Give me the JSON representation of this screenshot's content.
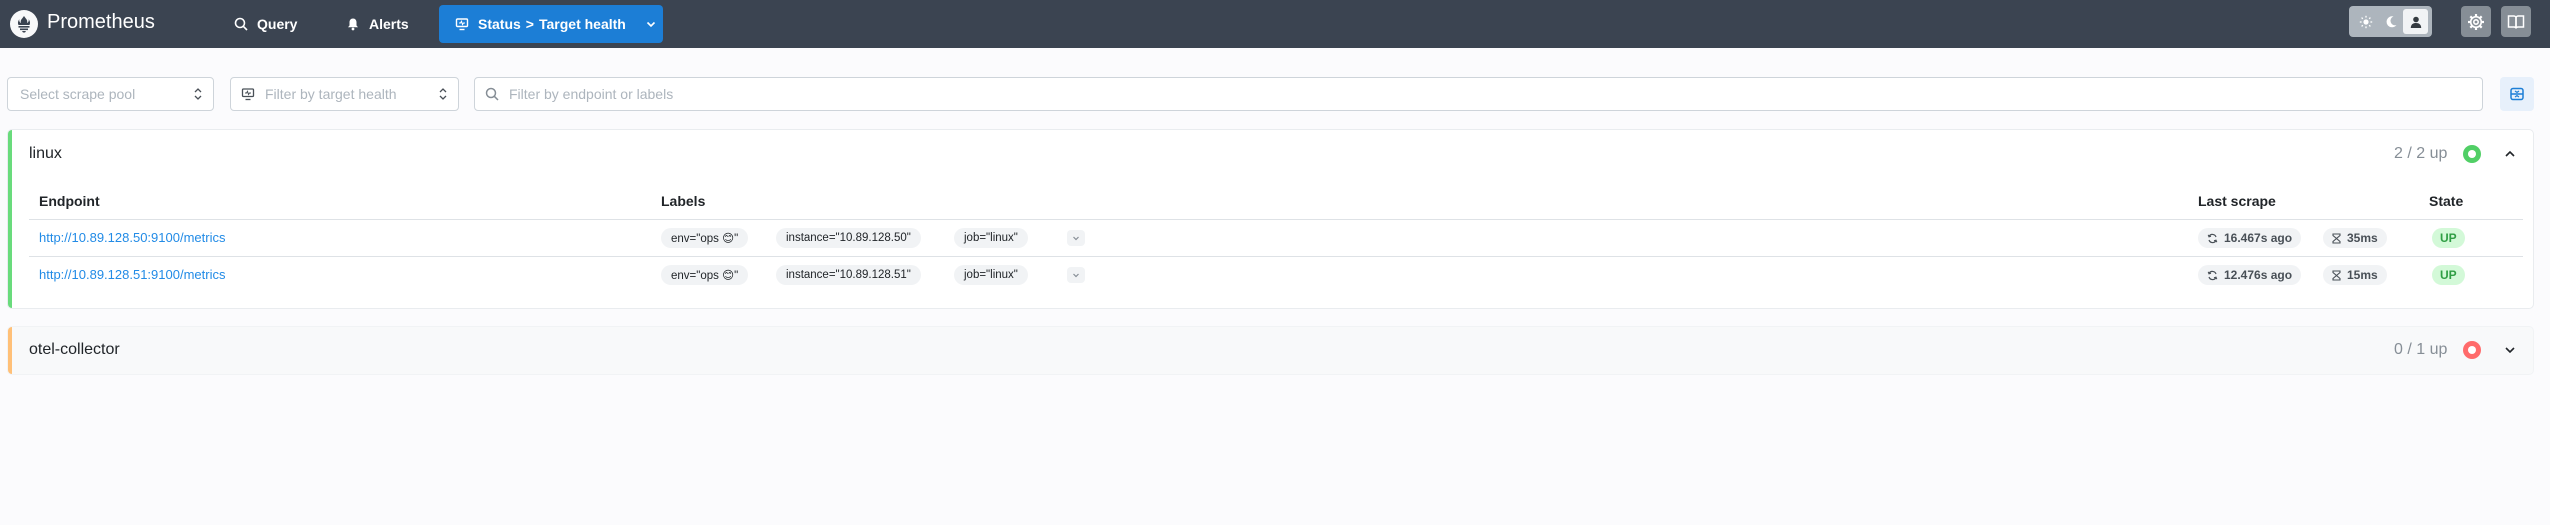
{
  "header": {
    "brand": "Prometheus",
    "nav": {
      "query": "Query",
      "alerts": "Alerts",
      "status_prefix": "Status",
      "status_separator": ">",
      "status_page": "Target health"
    },
    "colors": {
      "background": "#3b4451",
      "active": "#1c7ed6"
    },
    "icons": [
      "prometheus-logo",
      "search-icon",
      "bell-icon",
      "monitor-icon",
      "chevron-down-icon",
      "sun-icon",
      "moon-icon",
      "user-icon",
      "gear-icon",
      "book-icon"
    ]
  },
  "filters": {
    "scrape_pool_placeholder": "Select scrape pool",
    "health_placeholder": "Filter by target health",
    "search_placeholder": "Filter by endpoint or labels"
  },
  "table_headers": {
    "endpoint": "Endpoint",
    "labels": "Labels",
    "last_scrape": "Last scrape",
    "state": "State"
  },
  "pools": [
    {
      "name": "linux",
      "count": "2 / 2 up",
      "status": "healthy",
      "expanded": true,
      "targets": [
        {
          "endpoint": "http://10.89.128.50:9100/metrics",
          "labels": [
            "env=\"ops 😊\"",
            "instance=\"10.89.128.50\"",
            "job=\"linux\""
          ],
          "last_scrape": "16.467s ago",
          "duration": "35ms",
          "state": "UP"
        },
        {
          "endpoint": "http://10.89.128.51:9100/metrics",
          "labels": [
            "env=\"ops 😊\"",
            "instance=\"10.89.128.51\"",
            "job=\"linux\""
          ],
          "last_scrape": "12.476s ago",
          "duration": "15ms",
          "state": "UP"
        }
      ]
    },
    {
      "name": "otel-collector",
      "count": "0 / 1 up",
      "status": "unhealthy",
      "expanded": false
    }
  ],
  "colors": {
    "up_green": "#51cf66",
    "down_red": "#ff6b6b",
    "link_blue": "#228be6",
    "accent_orange": "#ffc078"
  }
}
